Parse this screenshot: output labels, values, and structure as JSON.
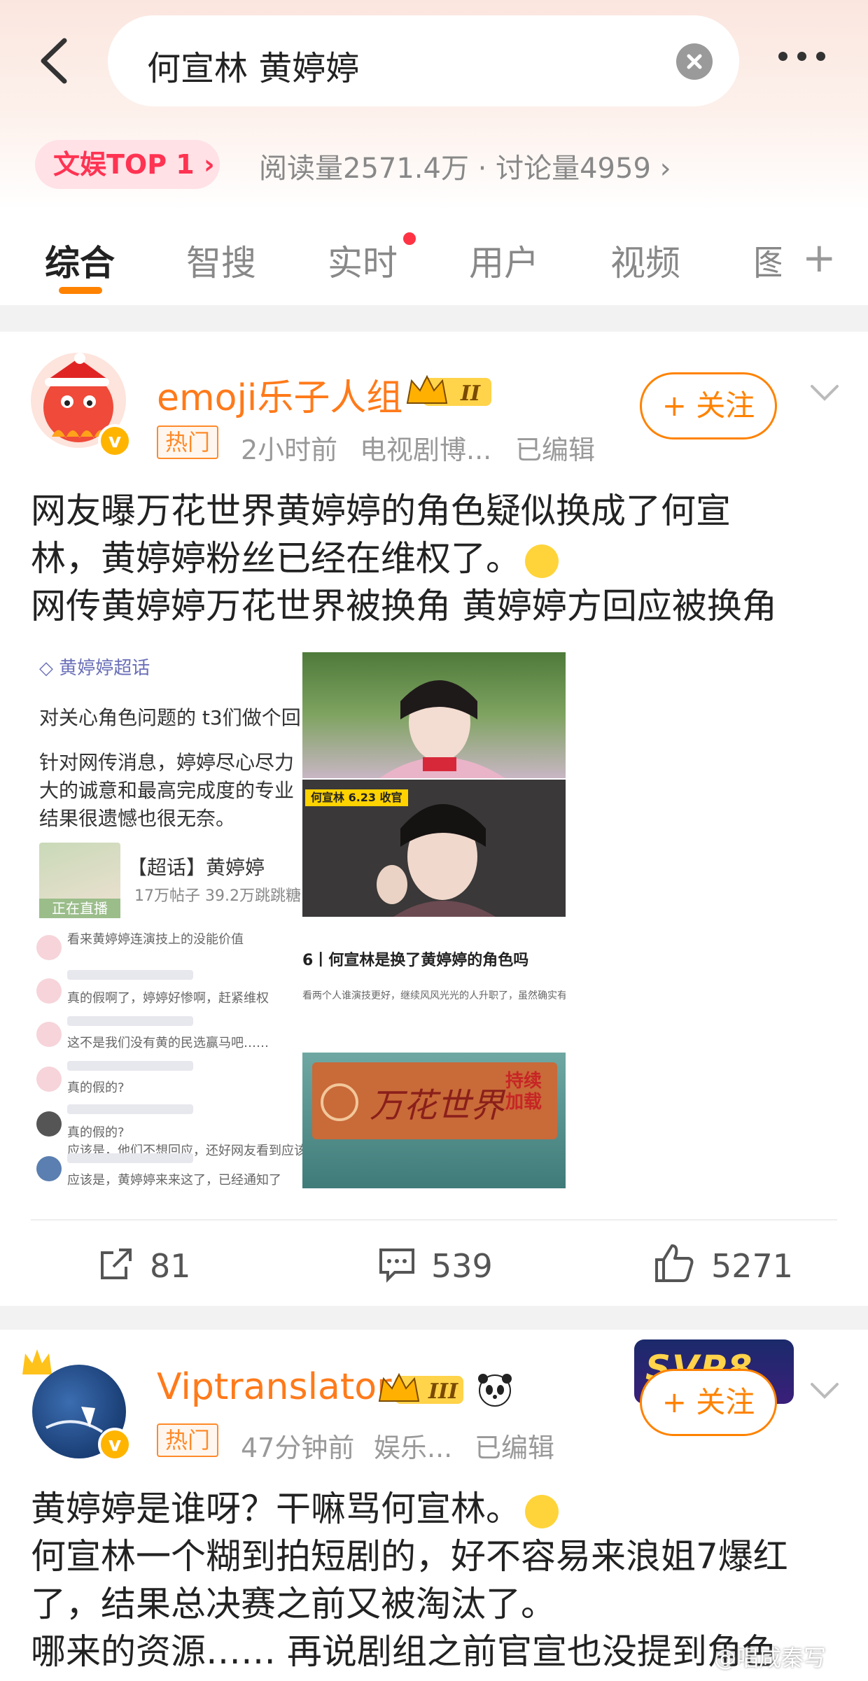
{
  "search": {
    "query": "何宣林 黄婷婷"
  },
  "topic": {
    "badge": "文娱TOP 1",
    "stats": "阅读量2571.4万 · 讨论量4959"
  },
  "tabs": [
    "综合",
    "智搜",
    "实时",
    "用户",
    "视频",
    "图"
  ],
  "post1": {
    "username": "emoji乐子人组",
    "hot": "热门",
    "time": "2小时前",
    "source": "电视剧博...",
    "edited": "已编辑",
    "follow": "+ 关注",
    "text_line1": "网友曝万花世界黄婷婷的角色疑似换成了何宣",
    "text_line2": "林，黄婷婷粉丝已经在维权了。",
    "text_line3": "网传黄婷婷万花世界被换角  黄婷婷方回应被换角",
    "image_left": {
      "supertopic": "黄婷婷超话",
      "line1": "对关心角色问题的 t3们做个回",
      "line2": "针对网传消息，婷婷尽心尽力",
      "line3": "大的诚意和最高完成度的专业",
      "line4": "结果很遗憾也很无奈。",
      "card_title": "【超话】黄婷婷",
      "card_stats": "17万帖子 39.2万跳跳糖",
      "live_tag": "正在直播",
      "comment1": "看来黄婷婷连演技上的没能价值",
      "comment2": "真的假啊了，婷婷好惨啊，赶紧维权",
      "comment3": "这不是我们没有黄的民选赢马吧……",
      "comment4": "真的假的?",
      "comment5": "真的假的?",
      "comment6": "应该是，他们不想回应，还好网友看到应该上来说说到现在",
      "comment7": "应该是，黄婷婷来来这了，已经通知了"
    },
    "image_right": {
      "tag": "何宣林 6.23 收官",
      "caption": "6丨何宣林是换了黄婷婷的角色吗",
      "subcaption": "看两个人谁演技更好，继续风风光光的人升职了，虽然确实有效参赛了但是开机",
      "poster_title": "万花世界",
      "poster_sub": "持续加载"
    },
    "reposts": "81",
    "comments": "539",
    "likes": "5271"
  },
  "post2": {
    "username": "Viptranslator",
    "hot": "热门",
    "time": "47分钟前",
    "source": "娱乐...",
    "edited": "已编辑",
    "follow": "+ 关注",
    "text_line1": "黄婷婷是谁呀？干嘛骂何宣林。",
    "text_line2": "何宣林一个糊到拍短剧的，好不容易来浪姐7爆红",
    "text_line3": "了，结果总决赛之前又被淘汰了。",
    "text_line4": "哪来的资源…… 再说剧组之前官宣也没提到角色",
    "watermark": "@唱咸秦写"
  },
  "colors": {
    "accent": "#ff8200",
    "hot": "#ff3352",
    "username": "#ff7a1a"
  }
}
